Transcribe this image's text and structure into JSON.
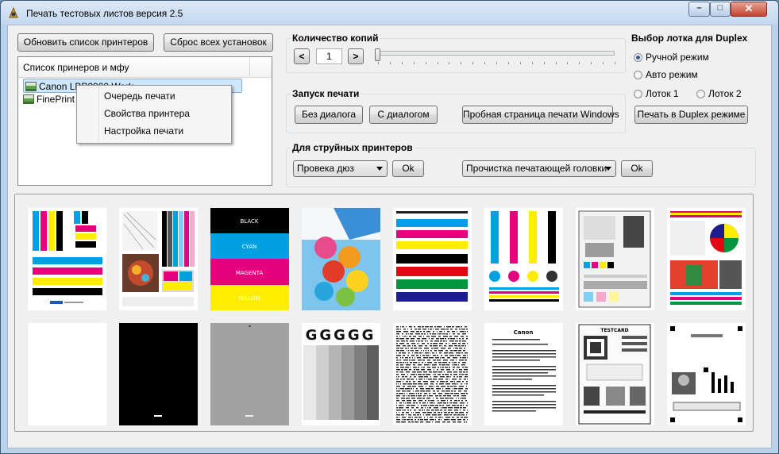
{
  "window": {
    "title": "Печать тестовых листов версия 2.5",
    "controls": [
      "minimize",
      "maximize",
      "close"
    ]
  },
  "toolbar": {
    "refresh_label": "Обновить список принтеров",
    "reset_label": "Сброс всех установок"
  },
  "printers": {
    "header": "Список принеров и мфу",
    "items": [
      {
        "label": "Canon LBP2900 Work",
        "selected": true
      },
      {
        "label": "FinePrint",
        "selected": false
      }
    ]
  },
  "context_menu": {
    "items": [
      "Очередь печати",
      "Свойства принтера",
      "Настройка печати"
    ]
  },
  "copies": {
    "title": "Количество копий",
    "dec_label": "<",
    "inc_label": ">",
    "value": "1",
    "slider_fraction": 0.0
  },
  "print_start": {
    "title": "Запуск печати",
    "no_dialog_label": "Без диалога",
    "with_dialog_label": "С диалогом",
    "windows_test_label": "Пробная страница печати Windows"
  },
  "inkjet": {
    "title": "Для струйных принтеров",
    "nozzle_select": "Провека дюз",
    "ok1_label": "Ok",
    "head_select": "Прочистка печатающей головки",
    "ok2_label": "Ok"
  },
  "duplex": {
    "title": "Выбор лотка для Duplex",
    "manual_label": "Ручной режим",
    "auto_label": "Авто режим",
    "tray1_label": "Лоток 1",
    "tray2_label": "Лоток 2",
    "selected": "manual",
    "print_label": "Печать в Duplex режиме"
  },
  "gallery": {
    "cmyk_labels": [
      "BLACK",
      "CYAN",
      "MAGENTA",
      "YELLOW"
    ],
    "gray_letters": "GGGGG",
    "canon_label": "Canon",
    "testcard_label": "TESTCARD",
    "colors": {
      "cyan": "#00a0e3",
      "magenta": "#e5007e",
      "yellow": "#ffed00",
      "black": "#000000",
      "red": "#e30613",
      "green": "#00963f",
      "blue": "#1d1d8f"
    }
  }
}
